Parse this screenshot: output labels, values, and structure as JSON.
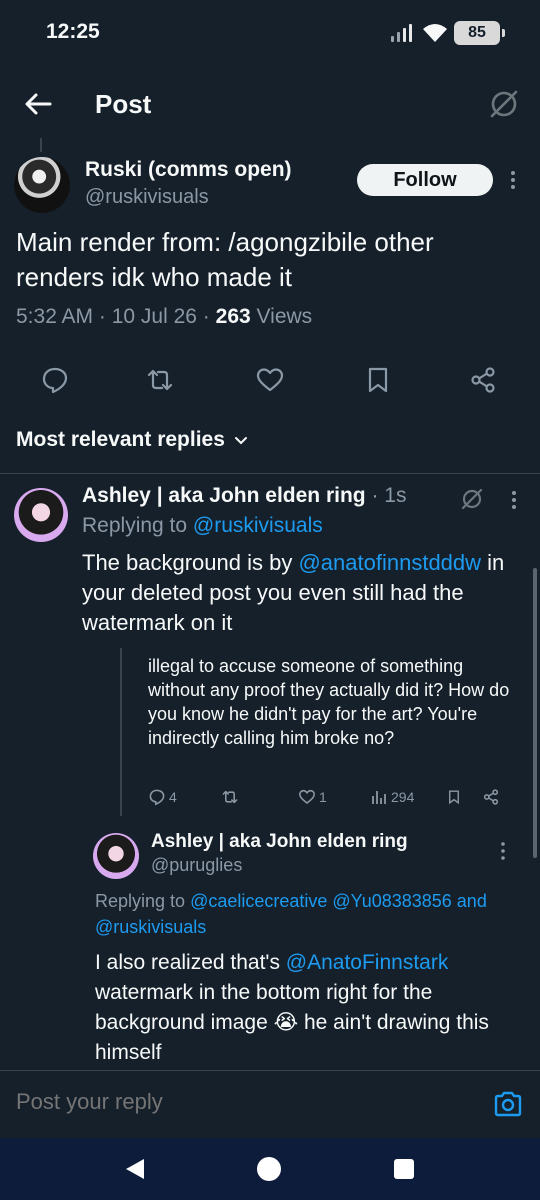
{
  "status_bar": {
    "time": "12:25",
    "battery": "85"
  },
  "header": {
    "title": "Post"
  },
  "post": {
    "author_name": "Ruski (comms open)",
    "author_handle": "@ruskivisuals",
    "follow_label": "Follow",
    "text": "Main render from: /agongzibile other renders idk who made it",
    "time": "5:32 AM",
    "date": "10 Jul 26",
    "views_count": "263",
    "views_label": "Views"
  },
  "replies_sort": {
    "label": "Most relevant replies"
  },
  "reply1": {
    "name": "Ashley | aka John elden ring",
    "age": "1s",
    "replying_prefix": "Replying to",
    "replying_handle": "@ruskivisuals",
    "text_before": "The background is by ",
    "mention": "@anatofinnstdddw",
    "text_after": " in your deleted post you even still had the watermark on it"
  },
  "quoted": {
    "text": "illegal to accuse someone of something without any proof they actually did it? How do you know he didn't pay for the art? You're indirectly calling him broke no?",
    "replies": "4",
    "likes": "1",
    "views": "294"
  },
  "reply2": {
    "name": "Ashley | aka John elden ring",
    "handle": "@puruglies",
    "replying_prefix": "Replying to",
    "replying_handles": "@caelicecreative @Yu08383856 and",
    "replying_handle_2": "@ruskivisuals",
    "text_before": "I also realized that's ",
    "mention": "@AnatoFinnstark",
    "text_after": " watermark in the bottom right for the background image 😭 he ain't drawing this himself"
  },
  "composer": {
    "placeholder": "Post your reply"
  },
  "colors": {
    "background": "#15202b",
    "accent": "#1d9bf0",
    "muted": "#8b98a5",
    "divider": "#38444d",
    "nav_bar": "#0e1c3c"
  },
  "icons": [
    "back-arrow-icon",
    "grok-icon",
    "more-icon",
    "reply-icon",
    "repost-icon",
    "like-icon",
    "bookmark-icon",
    "share-icon",
    "chevron-down-icon",
    "views-icon",
    "camera-icon",
    "signal-icon",
    "wifi-icon",
    "battery-icon"
  ]
}
